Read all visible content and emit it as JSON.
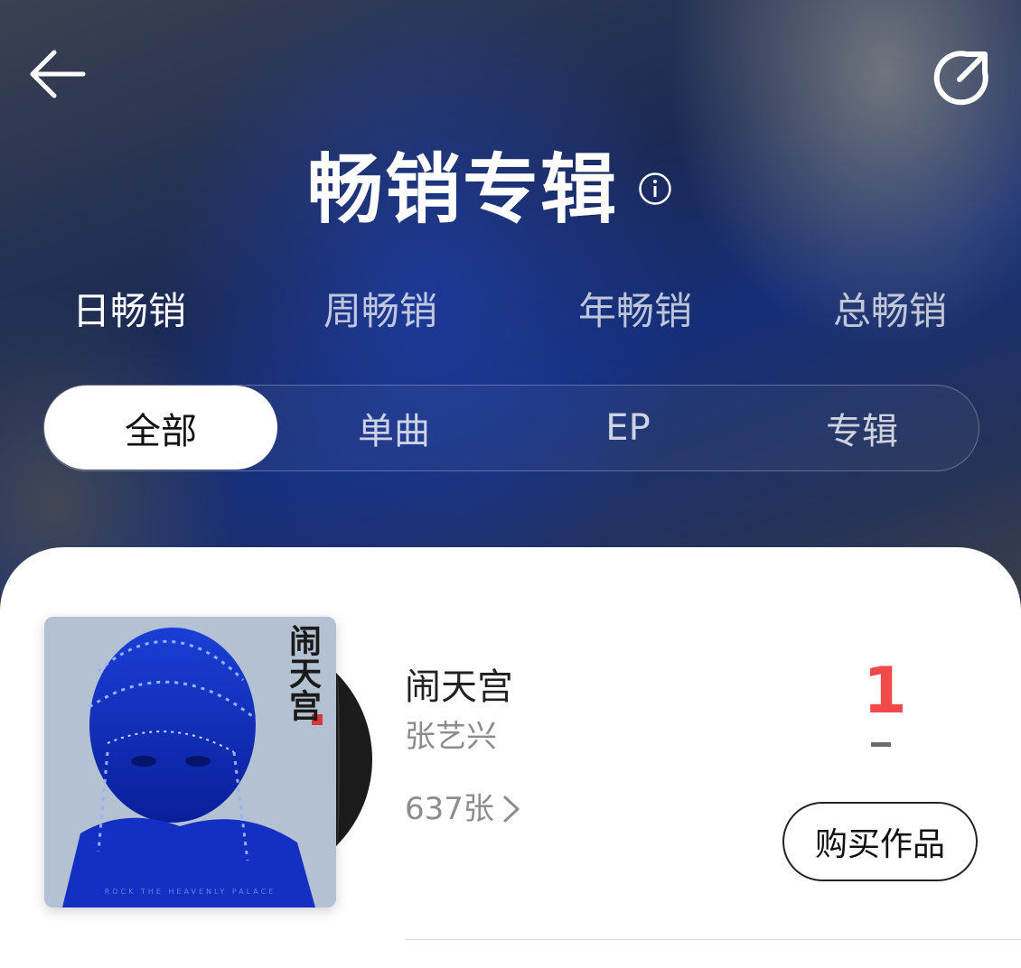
{
  "header": {
    "title": "畅销专辑",
    "back_icon": "arrow-left-icon",
    "share_icon": "share-icon",
    "info_icon": "info-icon"
  },
  "period_tabs": [
    {
      "label": "日畅销",
      "active": true
    },
    {
      "label": "周畅销",
      "active": false
    },
    {
      "label": "年畅销",
      "active": false
    },
    {
      "label": "总畅销",
      "active": false
    }
  ],
  "type_filter": [
    {
      "label": "全部",
      "active": true
    },
    {
      "label": "单曲",
      "active": false
    },
    {
      "label": "EP",
      "active": false
    },
    {
      "label": "专辑",
      "active": false
    }
  ],
  "albums": [
    {
      "title": "闹天宫",
      "artist": "张艺兴",
      "sales": "637张",
      "rank": "1",
      "buy_label": "购买作品",
      "cover_title": "闹天宫",
      "cover_subtitle": "ROCK THE HEAVENLY PALACE"
    }
  ],
  "colors": {
    "rank": "#f04a4a",
    "active_tab": "#ffffff",
    "card_bg": "#ffffff"
  }
}
